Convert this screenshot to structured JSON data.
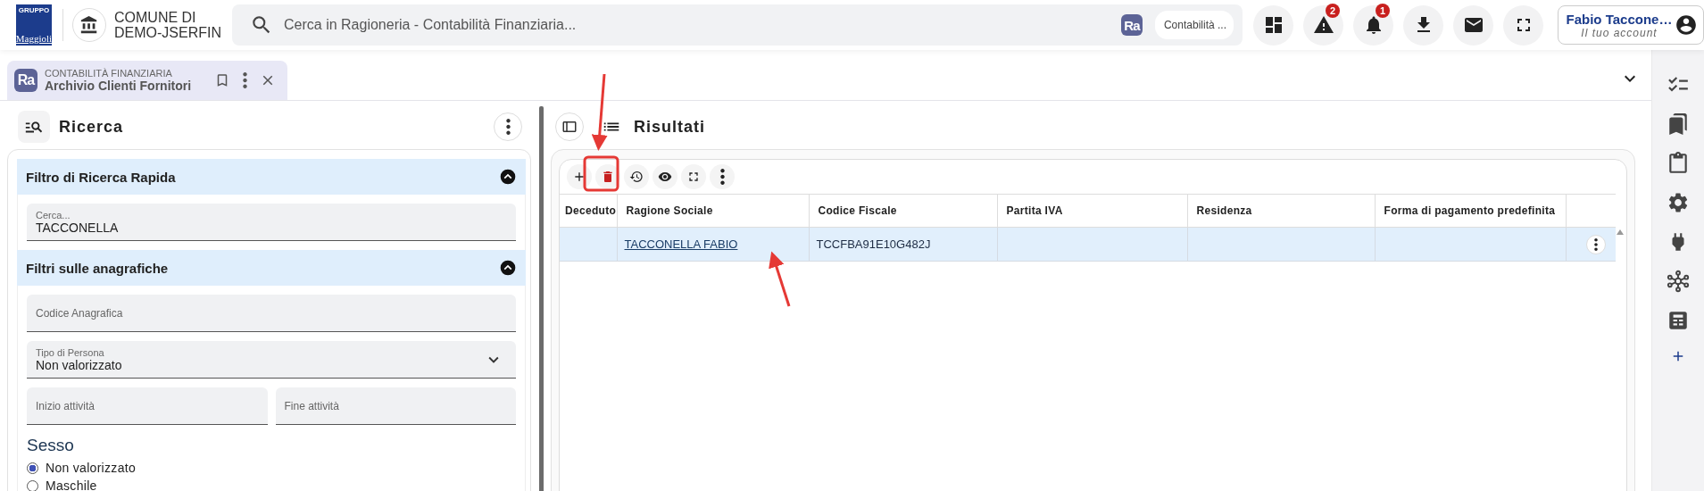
{
  "header": {
    "logo": {
      "top": "GRUPPO",
      "name": "Maggioli"
    },
    "org_lines": [
      "COMUNE DI",
      "DEMO-JSERFIN"
    ],
    "search": {
      "placeholder": "Cerca in Ragioneria - Contabilità Finanziaria..."
    },
    "module_badge": "Ra",
    "module_chip": "Contabilità ...",
    "actions": [
      {
        "kind": "dashboard"
      },
      {
        "kind": "warning",
        "badge": "2"
      },
      {
        "kind": "bell",
        "badge": "1"
      },
      {
        "kind": "download"
      },
      {
        "kind": "mail"
      },
      {
        "kind": "fullscreen"
      }
    ],
    "account": {
      "name": "Fabio Taccone…",
      "subtitle": "Il tuo account"
    }
  },
  "tabs": [
    {
      "badge": "Ra",
      "section": "CONTABILITÀ FINANZIARIA",
      "title": "Archivio Clienti Fornitori",
      "selected": true
    }
  ],
  "search_panel": {
    "title": "Ricerca",
    "sections": [
      {
        "title": "Filtro di Ricerca Rapida",
        "expanded": true,
        "fields": [
          {
            "kind": "text",
            "label": "Cerca...",
            "value": "TACCONELLA"
          }
        ]
      },
      {
        "title": "Filtri sulle anagrafiche",
        "expanded": true,
        "fields": [
          {
            "kind": "text",
            "placeholder": "Codice Anagrafica"
          },
          {
            "kind": "select",
            "label": "Tipo di Persona",
            "value": "Non valorizzato"
          },
          {
            "kind": "pair",
            "items": [
              {
                "placeholder": "Inizio attività"
              },
              {
                "placeholder": "Fine attività"
              }
            ]
          },
          {
            "kind": "radio",
            "title": "Sesso",
            "options": [
              {
                "label": "Non valorizzato",
                "selected": true
              },
              {
                "label": "Maschile",
                "selected": false
              }
            ]
          }
        ]
      }
    ]
  },
  "results_panel": {
    "title": "Risultati",
    "toolbar": [
      {
        "kind": "add"
      },
      {
        "kind": "delete"
      },
      {
        "kind": "history"
      },
      {
        "kind": "view"
      },
      {
        "kind": "fullscreen"
      },
      {
        "kind": "more"
      }
    ],
    "table": {
      "columns": [
        "Deceduto",
        "Ragione Sociale",
        "Codice Fiscale",
        "Partita IVA",
        "Residenza",
        "Forma di pagamento predefinita"
      ],
      "rows": [
        {
          "cells": [
            null,
            {
              "text": "TACCONELLA FABIO",
              "kind": "link"
            },
            {
              "text": "TCCFBA91E10G482J",
              "kind": "text"
            },
            null,
            null,
            null
          ],
          "selected": true
        }
      ]
    }
  },
  "sidebar": [
    {
      "kind": "checklist"
    },
    {
      "kind": "bookmarks"
    },
    {
      "kind": "clipboard"
    },
    {
      "kind": "gear"
    },
    {
      "kind": "plug"
    },
    {
      "kind": "hub"
    },
    {
      "kind": "calculator"
    },
    {
      "kind": "add"
    }
  ]
}
